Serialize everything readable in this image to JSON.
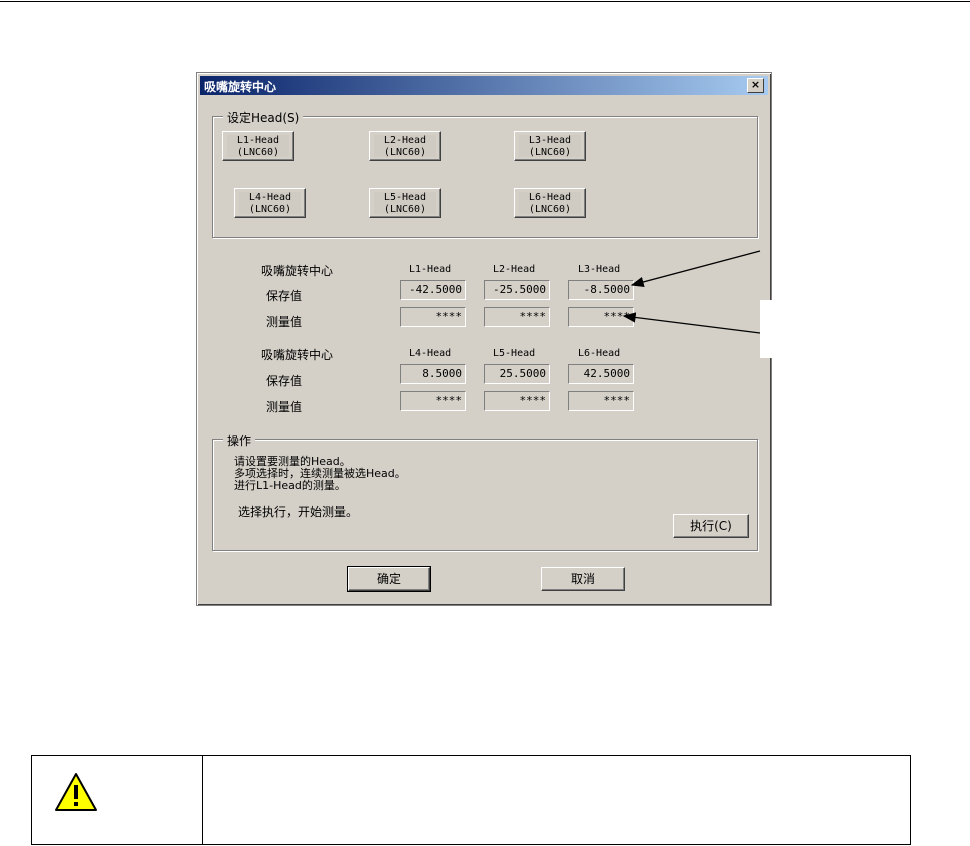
{
  "dialog": {
    "title": "吸嘴旋转中心",
    "close_label": "×"
  },
  "head_group": {
    "legend": "设定Head(S)",
    "buttons": [
      {
        "name": "L1-Head",
        "sub": "(LNC60)"
      },
      {
        "name": "L2-Head",
        "sub": "(LNC60)"
      },
      {
        "name": "L3-Head",
        "sub": "(LNC60)"
      },
      {
        "name": "L4-Head",
        "sub": "(LNC60)"
      },
      {
        "name": "L5-Head",
        "sub": "(LNC60)"
      },
      {
        "name": "L6-Head",
        "sub": "(LNC60)"
      }
    ]
  },
  "centers": [
    {
      "title": "吸嘴旋转中心",
      "columns": [
        "L1-Head",
        "L2-Head",
        "L3-Head"
      ],
      "saved_label": "保存值",
      "saved_values": [
        "-42.5000",
        "-25.5000",
        "-8.5000"
      ],
      "measured_label": "测量值",
      "measured_values": [
        "****",
        "****",
        "****"
      ]
    },
    {
      "title": "吸嘴旋转中心",
      "columns": [
        "L4-Head",
        "L5-Head",
        "L6-Head"
      ],
      "saved_label": "保存值",
      "saved_values": [
        "8.5000",
        "25.5000",
        "42.5000"
      ],
      "measured_label": "测量值",
      "measured_values": [
        "****",
        "****",
        "****"
      ]
    }
  ],
  "operation": {
    "legend": "操作",
    "lines": [
      "请设置要测量的Head。",
      "多项选择时，连续测量被选Head。",
      "进行L1-Head的测量。"
    ],
    "hint": "选择执行，开始测量。",
    "execute_label": "执行(C)"
  },
  "footer": {
    "ok_label": "确定",
    "cancel_label": "取消"
  },
  "caution": {
    "icon": "warning-triangle-icon",
    "icon_color": "#ffff00"
  }
}
